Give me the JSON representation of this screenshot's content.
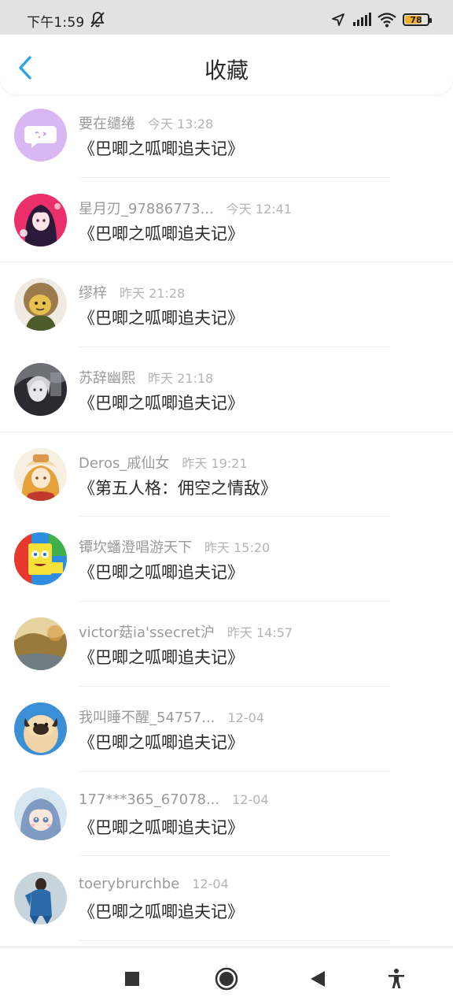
{
  "status_bar": {
    "time": "下午1:59",
    "battery_level": "78",
    "battery_fraction": 0.78,
    "battery_color": "#f0b02b",
    "icons": [
      "mute-bell-icon",
      "location-arrow-icon",
      "signal-icon",
      "wifi-icon",
      "battery-icon"
    ]
  },
  "header": {
    "title": "收藏",
    "back_icon": "chevron-left-icon",
    "accent_color": "#2aa3e8"
  },
  "items": [
    {
      "name": "要在缱绻",
      "time": "今天 13:28",
      "title": "《巴唧之呱唧追夫记》",
      "avatar": "chat-bubble-avatar"
    },
    {
      "name": "星月刃_97886773...",
      "time": "今天 12:41",
      "title": "《巴唧之呱唧追夫记》",
      "avatar": "anime-girl-avatar"
    },
    {
      "name": "缪梓",
      "time": "昨天 21:28",
      "title": "《巴唧之呱唧追夫记》",
      "avatar": "green-character-avatar"
    },
    {
      "name": "苏辞幽熙",
      "time": "昨天 21:18",
      "title": "《巴唧之呱唧追夫记》",
      "avatar": "grey-sketch-avatar"
    },
    {
      "name": "Deros_戚仙女",
      "time": "昨天 19:21",
      "title": "《第五人格：佣空之情敌》",
      "avatar": "hat-girl-avatar"
    },
    {
      "name": "镡坎蟠澄唱游天下",
      "time": "昨天 15:20",
      "title": "《巴唧之呱唧追夫记》",
      "avatar": "sponge-cartoon-avatar"
    },
    {
      "name": "victor菇ia'ssecret沪",
      "time": "昨天 14:57",
      "title": "《巴唧之呱唧追夫记》",
      "avatar": "autumn-landscape-avatar"
    },
    {
      "name": "我叫睡不醒_54757...",
      "time": "12-04",
      "title": "《巴唧之呱唧追夫记》",
      "avatar": "pug-dog-avatar"
    },
    {
      "name": "177***365_67078...",
      "time": "12-04",
      "title": "《巴唧之呱唧追夫记》",
      "avatar": "chibi-girl-avatar"
    },
    {
      "name": "toerybrurchbe",
      "time": "12-04",
      "title": "《巴唧之呱唧追夫记》",
      "avatar": "blue-outfit-avatar"
    }
  ],
  "system_nav": {
    "buttons": [
      "recent-apps-icon",
      "home-icon",
      "back-triangle-icon",
      "accessibility-icon"
    ]
  }
}
